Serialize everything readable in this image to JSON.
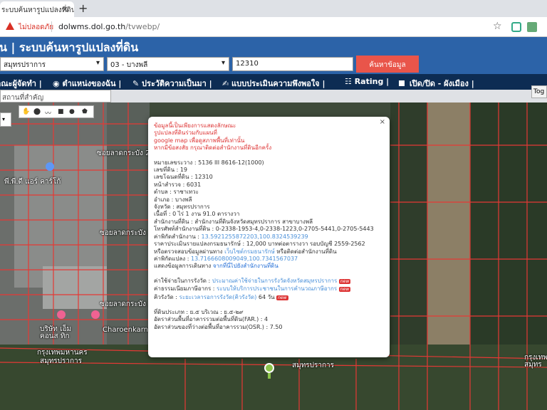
{
  "browser": {
    "tab_title": "ระบบค้นหารูปแปลงที่ดิน",
    "insecure_label": "ไม่ปลอดภัย",
    "url_host": "dolwms.dol.go.th",
    "url_path": "/tvwebp/"
  },
  "header": {
    "title": "ที่ดิน | ระบบค้นหารูปแปลงที่ดิน"
  },
  "search": {
    "province_value": "สมุทรปราการ",
    "district_value": "03 - บางพลี",
    "parcel_value": "12310",
    "submit_label": "ค้นหาข้อมูล"
  },
  "menu": {
    "items": [
      "คณะผู้จัดทำ",
      "ตำแหน่งของฉัน",
      "ประวัติความเป็นมา",
      "แบบประเมินความพึงพอใจ",
      "Rating",
      "เปิด/ปิด - ผังเมือง"
    ]
  },
  "map": {
    "place_placeholder": "สถานที่สำคัญ",
    "side_button": "Tog",
    "labels": [
      "ซอยลาดกระบัง 2",
      "พี.พี.ดี แอร์ คาร์โก้",
      "ซอยลาดกระบัง 2",
      "ซอยลาดกระบัง 2",
      "บริษัท เอ็ม คอนส ทิก",
      "Charoenkarnasil's H",
      "กรุงเทพมหานคร",
      "สมุทรปราการ",
      "สมุทรปราการ",
      "กรุงเทพ สมุทร"
    ]
  },
  "popup": {
    "notice": [
      "ข้อมูลนี้เป็นเพียงการแสดงลักษณะ",
      "รูปแปลงที่ดินร่วมกับแผนที่",
      "google map เพื่อดูสภาพพื้นที่เท่านั้น",
      "หากมีข้อสงสัย กรุณาติดต่อสำนักงานที่ดินอีกครั้ง"
    ],
    "details": [
      "หมายเลขระวาง : 5136 III 8616-12(1000)",
      "เลขที่ดิน : 19",
      "เลขโฉนดที่ดิน : 12310",
      "หน้าสำรวจ : 6031",
      "ตำบล : ราชาเทวะ",
      "อำเภอ : บางพลี",
      "จังหวัด : สมุทรปราการ",
      "เนื้อที่ : 0 ไร่ 1 งาน 91.0 ตารางวา",
      "สำนักงานที่ดิน : สำนักงานที่ดินจังหวัดสมุทรปราการ สาขาบางพลี",
      "โทรศัพท์สำนักงานที่ดิน : 0-2338-1953-4,0-2338-1223,0-2705-5441,0-2705-5443"
    ],
    "office_coord_label": "ค่าพิกัดสำนักงาน : ",
    "office_coord_value": "13.5921255872203,100.8324539239",
    "price_line": "ราคาประเมินรายแปลงกรมธนารักษ์ : 12,000 บาทต่อตารางวา รอบบัญชี 2559-2562",
    "check_prefix": "หรือตรวจสอบข้อมูลผ่านทาง ",
    "check_link": "เว็บไซต์กรมธนารักษ์",
    "check_suffix": " หรือติดต่อสำนักงานที่ดิน",
    "parcel_coord_label": "ค่าพิกัดแปลง : ",
    "parcel_coord_value": "13.7166608009049,100.7341567037",
    "route_prefix": "แสดงข้อมูลการเดินทาง ",
    "route_link": "จากที่นี่ไปยังสำนักงานที่ดิน",
    "cost_label": "ค่าใช้จ่ายในการรังวัด : ",
    "cost_link": "ประมาณค่าใช้จ่ายในการรังวัดจังหวัดสมุทรปราการ",
    "fee_label": "ค่าธรรมเนียมภาษีอากร : ",
    "fee_link": "ระบบให้บริการประชาชนในการคำนวณภาษีอากร",
    "queue_label": "คิวรังวัด : ",
    "queue_link": "ระยะเวลารอการรังวัด(คิวรังวัด)",
    "queue_value": " 64 วัน",
    "new_badge": "new",
    "zoning_line": "ที่ดินประเภท : ย.๕ บริเวณ : ย.๕-๒๙",
    "far_line": "อัตราส่วนพื้นที่อาคารรวมต่อพื้นที่ดิน(FAR.) : 4",
    "osr_line": "อัตราส่วนของที่ว่างต่อพื้นที่อาคารรวม(OSR.) : 7.50",
    "close_glyph": "×"
  },
  "icons": {
    "new_tab": "+",
    "star": "☆",
    "caret": "▾"
  },
  "colors": {
    "header_blue": "#2c63a8",
    "menu_navy": "#0d2c53",
    "search_button": "#e9554a",
    "parcel_red": "#e53935"
  }
}
